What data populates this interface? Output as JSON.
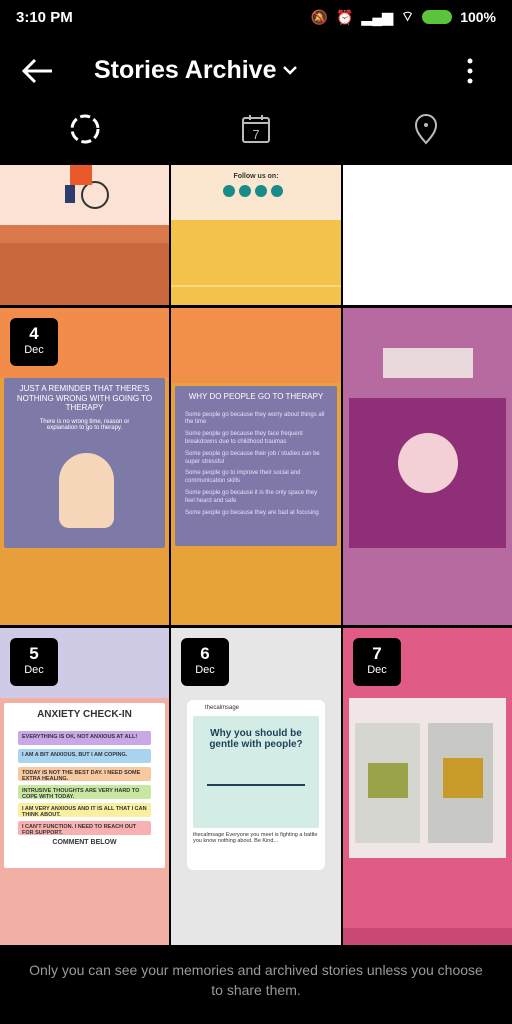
{
  "status_bar": {
    "time": "3:10 PM",
    "battery": "100%"
  },
  "header": {
    "title": "Stories Archive"
  },
  "tabs": [
    {
      "icon": "stories-ring-icon"
    },
    {
      "icon": "calendar-icon",
      "label": "7"
    },
    {
      "icon": "location-pin-icon"
    }
  ],
  "grid": {
    "row1": [
      {
        "caption": "Follow us on:"
      }
    ],
    "row2": [
      {
        "day": "4",
        "month": "Dec",
        "headline": "JUST A REMINDER THAT THERE'S NOTHING WRONG WITH GOING TO THERAPY",
        "sub": "There is no wrong time, reason or explanation to go to therapy."
      },
      {
        "headline": "WHY DO PEOPLE GO TO THERAPY",
        "bullets": [
          "Some people go because they worry about things all the time",
          "Some people go because they face frequent breakdowns due to childhood traumas",
          "Some people go because their job / studies can be super stressful",
          "Some people go to improve their social and communication skills",
          "Some people go because it is the only space they feel heard and safe",
          "Some people go because they are bad at focusing"
        ]
      },
      {}
    ],
    "row3": [
      {
        "day": "5",
        "month": "Dec",
        "headline": "ANXIETY CHECK-IN",
        "items": [
          "EVERYTHING IS OK, NOT ANXIOUS AT ALL!",
          "I AM A BIT ANXIOUS, BUT I AM COPING.",
          "TODAY IS NOT THE BEST DAY. I NEED SOME EXTRA HEALING.",
          "INTRUSIVE THOUGHTS ARE VERY HARD TO COPE WITH TODAY.",
          "I AM VERY ANXIOUS AND IT IS ALL THAT I CAN THINK ABOUT.",
          "I CAN'T FUNCTION. I NEED TO REACH OUT FOR SUPPORT."
        ],
        "footer": "COMMENT BELOW"
      },
      {
        "day": "6",
        "month": "Dec",
        "account": "thecalmsage",
        "headline": "Why you should be gentle with people?",
        "caption": "thecalmsage Everyone you meet is fighting a battle you know nothing about. Be Kind..."
      },
      {
        "day": "7",
        "month": "Dec"
      }
    ]
  },
  "footer": {
    "text": "Only you can see your memories and archived stories unless you choose to share them."
  }
}
